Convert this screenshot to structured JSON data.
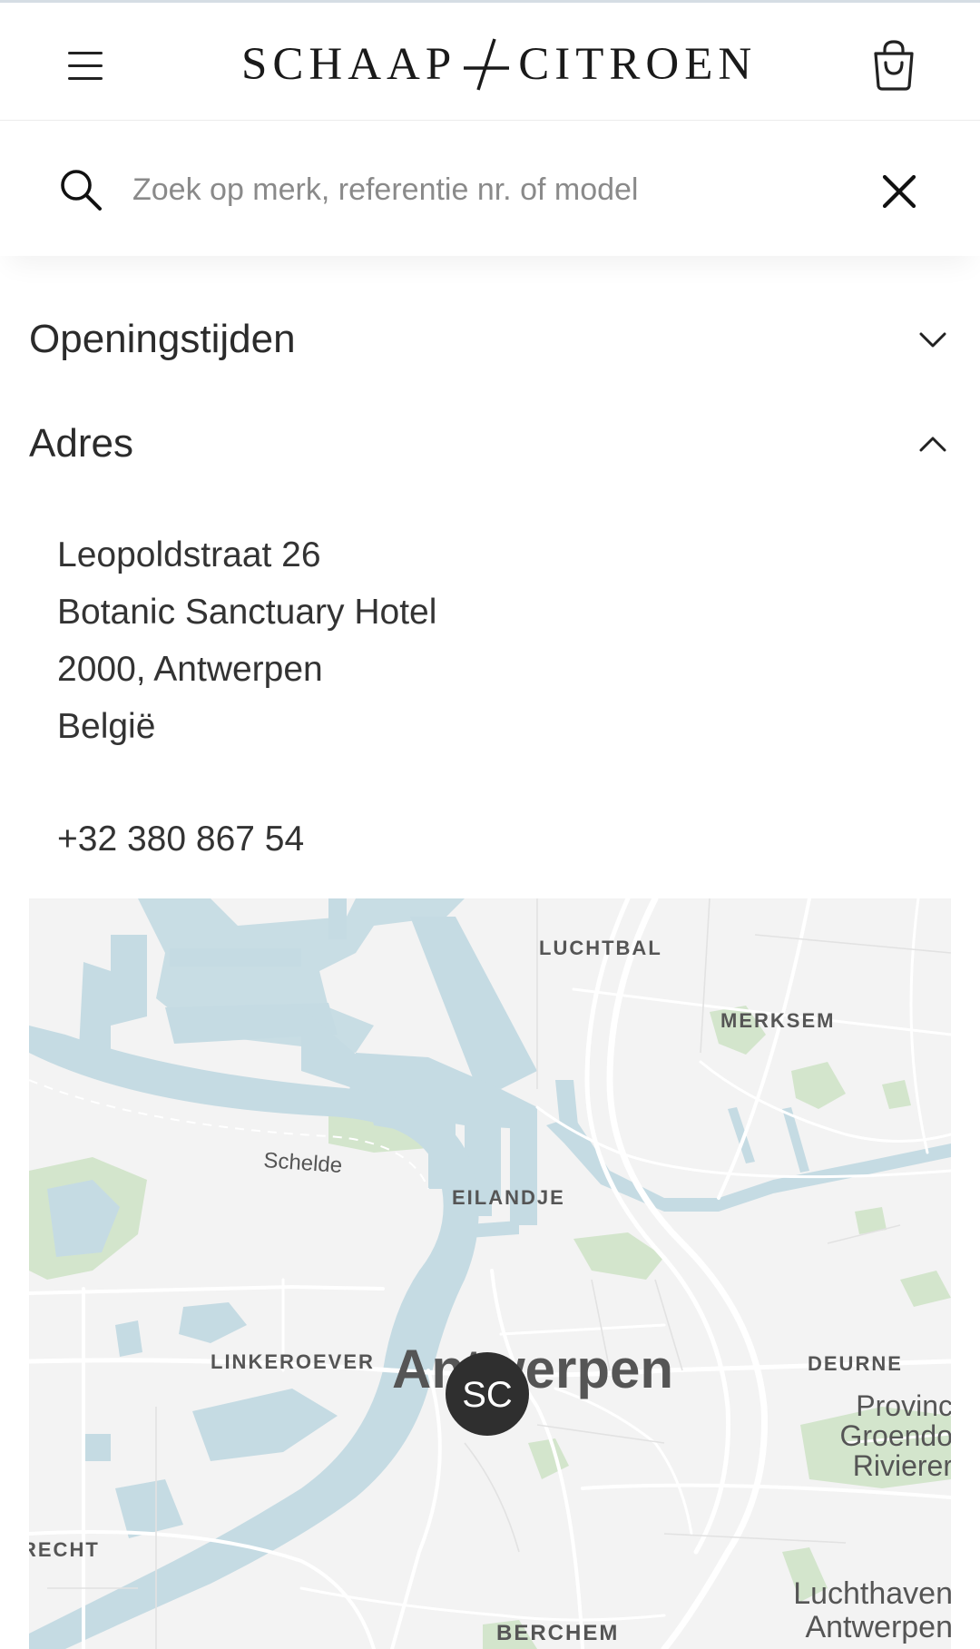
{
  "header": {
    "brand_left": "SCHAAP",
    "brand_right": "CITROEN",
    "menu_icon": "hamburger-menu-icon",
    "cart_icon": "shopping-bag-icon"
  },
  "search": {
    "placeholder": "Zoek op merk, referentie nr. of model",
    "value": "",
    "search_icon": "search-icon",
    "close_icon": "close-icon"
  },
  "sections": {
    "opening_hours": {
      "title": "Openingstijden",
      "state": "collapsed",
      "icon": "chevron-down-icon"
    },
    "address": {
      "title": "Adres",
      "state": "expanded",
      "icon": "chevron-up-icon"
    }
  },
  "address": {
    "street": "Leopoldstraat 26",
    "venue": "Botanic Sanctuary Hotel",
    "city": "2000, Antwerpen",
    "country": "België",
    "phone": "+32 380 867 54"
  },
  "map": {
    "marker_label": "SC",
    "labels": {
      "luchtbal": "LUCHTBAL",
      "merksem": "MERKSEM",
      "schelde": "Schelde",
      "eilandje": "EILANDJE",
      "linkeroever": "LINKEROEVER",
      "antwerpen": "Antwerpen",
      "deurne": "DEURNE",
      "provinc_1": "Provinc",
      "provinc_2": "Groendo",
      "provinc_3": "Rivierer",
      "zwijndrecht_partial": "RECHT",
      "luchthaven_1": "Luchthaven",
      "luchthaven_2": "Antwerpen",
      "berchem": "BERCHEM"
    },
    "colors": {
      "land": "#f3f3f3",
      "water": "#c5dbe3",
      "park": "#cfe3c8",
      "road": "#ffffff",
      "marker": "#2f2f2f"
    }
  }
}
